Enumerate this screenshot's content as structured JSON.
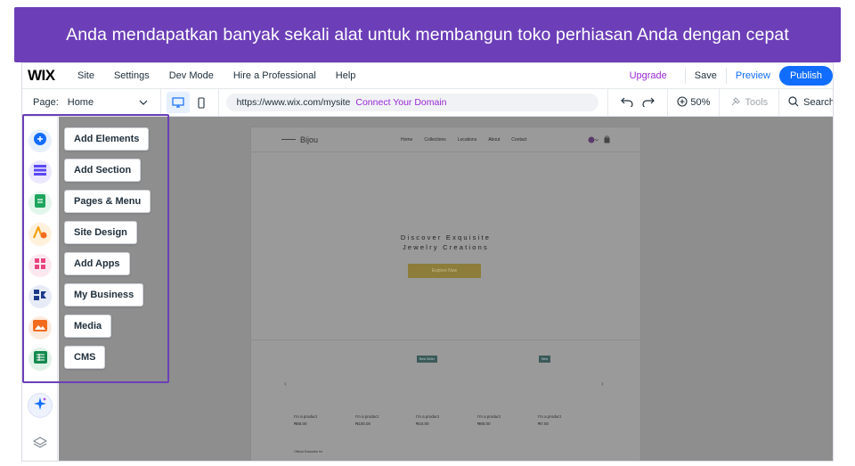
{
  "caption": "Anda mendapatkan banyak sekali alat untuk membangun toko perhiasan Anda dengan cepat",
  "topbar": {
    "logo": "WIX",
    "menu": [
      "Site",
      "Settings",
      "Dev Mode",
      "Hire a Professional",
      "Help"
    ],
    "upgrade": "Upgrade",
    "save": "Save",
    "preview": "Preview",
    "publish": "Publish"
  },
  "bar2": {
    "page_label": "Page:",
    "page_value": "Home",
    "url": "https://www.wix.com/mysite",
    "connect": "Connect Your Domain",
    "zoom": "50%",
    "tools": "Tools",
    "search": "Search"
  },
  "panel": {
    "items": [
      {
        "label": "Add Elements",
        "icon": "plus-icon",
        "color": "#116dff",
        "bg": "#e7f0ff"
      },
      {
        "label": "Add Section",
        "icon": "section-icon",
        "color": "#5a48f5",
        "bg": "#ebe8ff"
      },
      {
        "label": "Pages & Menu",
        "icon": "page-icon",
        "color": "#1ea55e",
        "bg": "#e3f6ec"
      },
      {
        "label": "Site Design",
        "icon": "design-icon",
        "color": "#f59e0b",
        "bg": "#fff1dc"
      },
      {
        "label": "Add Apps",
        "icon": "apps-icon",
        "color": "#e8457a",
        "bg": "#fde8ef"
      },
      {
        "label": "My Business",
        "icon": "business-icon",
        "color": "#1d3a8a",
        "bg": "#e6ebf7"
      },
      {
        "label": "Media",
        "icon": "media-icon",
        "color": "#f26b1d",
        "bg": "#feeadd"
      },
      {
        "label": "CMS",
        "icon": "cms-icon",
        "color": "#138a4e",
        "bg": "#e1f3e8"
      }
    ]
  },
  "site": {
    "brand": "Bijou",
    "nav": [
      "Home",
      "Collections",
      "Locations",
      "About",
      "Contact"
    ],
    "hero_line1": "Discover Exquisite",
    "hero_line2": "Jewelry Creations",
    "hero_button": "Explore Now",
    "badge1": "Best Seller",
    "badge2": "New",
    "products": [
      {
        "name": "I'm a product",
        "price": "₦85.00"
      },
      {
        "name": "I'm a product",
        "price": "₦100.00"
      },
      {
        "name": "I'm a product",
        "price": "₦10.00"
      },
      {
        "name": "I'm a product",
        "price": "₦85.00"
      },
      {
        "name": "I'm a product",
        "price": "₦7.50"
      }
    ],
    "footer_note": "Official Subscribe for"
  }
}
